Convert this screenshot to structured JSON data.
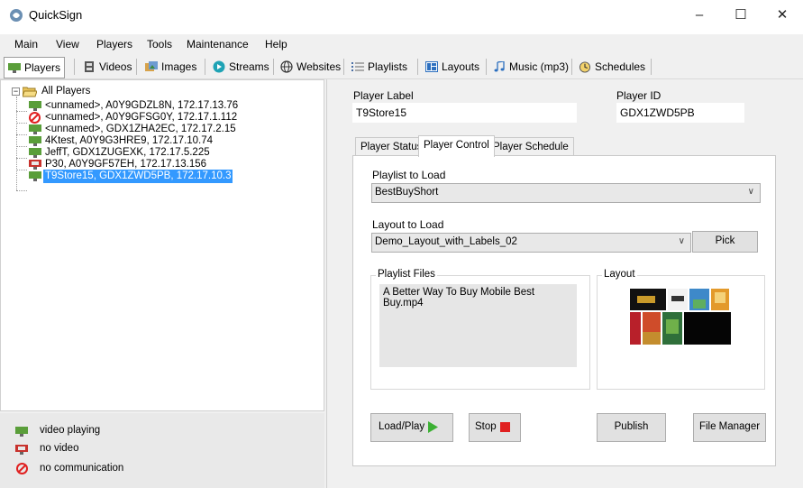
{
  "window": {
    "title": "QuickSign",
    "minimize": "–",
    "maximize": "☐",
    "close": "✕"
  },
  "menu": [
    "Main",
    "View",
    "Players",
    "Tools",
    "Maintenance",
    "Help"
  ],
  "toolbar": [
    {
      "label": "Players",
      "icon": "player-icon"
    },
    {
      "label": "Videos",
      "icon": "film-icon"
    },
    {
      "label": "Images",
      "icon": "images-icon"
    },
    {
      "label": "Streams",
      "icon": "stream-play-icon"
    },
    {
      "label": "Websites",
      "icon": "globe-icon"
    },
    {
      "label": "Playlists",
      "icon": "list-icon"
    },
    {
      "label": "Layouts",
      "icon": "layout-icon"
    },
    {
      "label": "Music (mp3)",
      "icon": "music-note-icon"
    },
    {
      "label": "Schedules",
      "icon": "clock-icon"
    }
  ],
  "tree": {
    "root": "All Players",
    "items": [
      {
        "label": "<unnamed>, A0Y9GDZL8N, 172.17.13.76",
        "status": "video playing"
      },
      {
        "label": "<unnamed>, A0Y9GFSG0Y, 172.17.1.112",
        "status": "no communication"
      },
      {
        "label": "<unnamed>, GDX1ZHA2EC, 172.17.2.15",
        "status": "video playing"
      },
      {
        "label": "4Ktest, A0Y9G3HRE9, 172.17.10.74",
        "status": "video playing"
      },
      {
        "label": "JeffT, GDX1ZUGEXK, 172.17.5.225",
        "status": "video playing"
      },
      {
        "label": "P30, A0Y9GF57EH, 172.17.13.156",
        "status": "no video"
      },
      {
        "label": "T9Store15, GDX1ZWD5PB, 172.17.10.3",
        "status": "video playing",
        "selected": true
      }
    ]
  },
  "legend": [
    {
      "label": "video playing",
      "icon": "monitor-green-icon"
    },
    {
      "label": "no video",
      "icon": "monitor-red-icon"
    },
    {
      "label": "no communication",
      "icon": "no-entry-icon"
    }
  ],
  "player": {
    "label_caption": "Player Label",
    "label_value": "T9Store15",
    "id_caption": "Player ID",
    "id_value": "GDX1ZWD5PB"
  },
  "tabs": [
    "Player Status",
    "Player Control",
    "Player Schedule"
  ],
  "control": {
    "playlist_caption": "Playlist to Load",
    "playlist_value": "BestBuyShort",
    "layout_caption": "Layout to Load",
    "layout_value": "Demo_Layout_with_Labels_02",
    "pick": "Pick",
    "playlist_files_caption": "Playlist Files",
    "playlist_files": [
      "A Better Way To Buy Mobile  Best Buy.mp4"
    ],
    "layout_caption_box": "Layout",
    "load_play": "Load/Play",
    "stop": "Stop",
    "publish": "Publish",
    "file_manager": "File Manager"
  },
  "colors": {
    "selection": "#3399ff",
    "play_green": "#3cb034",
    "stop_red": "#e02020",
    "monitor_green": "#5a9e3a",
    "monitor_red": "#c8322d"
  }
}
